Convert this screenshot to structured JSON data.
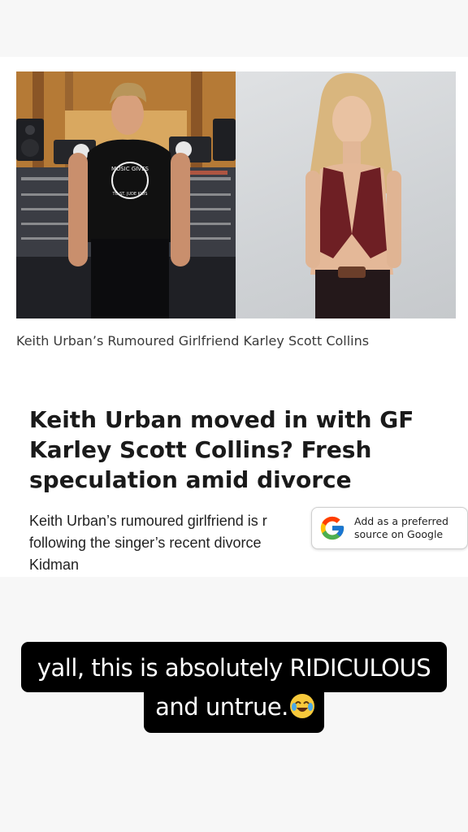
{
  "article": {
    "caption": "Keith Urban’s Rumoured Girlfriend Karley Scott Collins",
    "headline": "Keith Urban moved in with GF Karley Scott Collins? Fresh speculation amid divorce",
    "summary": "Keith Urban’s rumoured girlfriend is r following the singer’s recent divorce Kidman",
    "shirt_text_top": "MUSIC GIVES",
    "shirt_text_bottom": "TO ST. JUDE KIDS"
  },
  "google_badge": {
    "line1": "Add as a preferred",
    "line2": "source on Google",
    "icon": "google-g-icon"
  },
  "story_overlay": {
    "line1": "yall, this is absolutely RIDICULOUS",
    "line2": "and untrue.",
    "emoji": "face-with-tears-of-joy-icon"
  }
}
